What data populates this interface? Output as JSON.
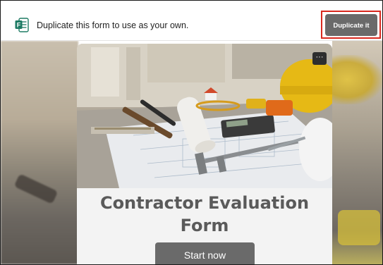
{
  "banner": {
    "app_icon": "forms-icon",
    "message": "Duplicate this form to use as your own.",
    "duplicate_label": "Duplicate it",
    "highlight_color": "#d9281e"
  },
  "form": {
    "cover_image": "construction-blueprint-tools-photo",
    "more_icon": "ellipsis-icon",
    "more_label": "···",
    "title": "Contractor Evaluation Form",
    "start_label": "Start now"
  },
  "colors": {
    "button_bg": "#6a6a6a",
    "title_color": "#5a5a5a",
    "forms_brand": "#1e7b64"
  }
}
